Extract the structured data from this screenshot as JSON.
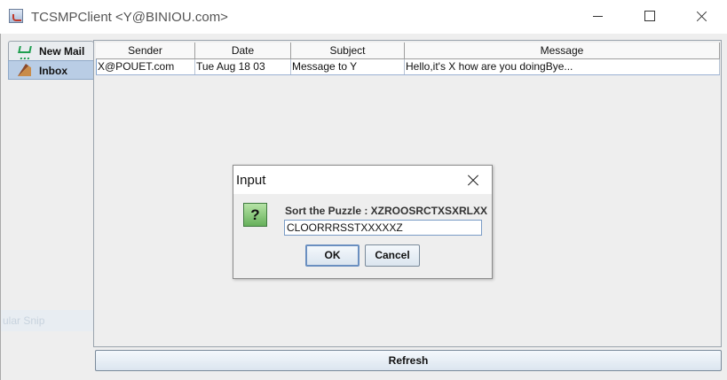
{
  "window": {
    "title": "TCSMPClient <Y@BINIOU.com>",
    "icon": "java-coffee-icon"
  },
  "tabs": [
    {
      "label": "New Mail",
      "icon": "shopping-cart-icon"
    },
    {
      "label": "Inbox",
      "icon": "inbox-icon",
      "selected": true
    }
  ],
  "table": {
    "columns": [
      "Sender",
      "Date",
      "Subject",
      "Message"
    ],
    "rows": [
      {
        "sender": "X@POUET.com",
        "date": "Tue Aug 18 03",
        "subject": "Message to Y",
        "message": "Hello,it's X how are you doingBye..."
      }
    ]
  },
  "refresh_label": "Refresh",
  "background_ghost_text": "ular Snip",
  "dialog": {
    "title": "Input",
    "prompt": "Sort the Puzzle : XZROOSRCTXSXRLXX",
    "input_value": "CLOORRRSSTXXXXXZ",
    "ok_label": "OK",
    "cancel_label": "Cancel",
    "icon": "question-icon"
  },
  "colors": {
    "selected_tab": "#b9cde5",
    "question_icon": "#66b05a",
    "accent_border": "#7a9cc6"
  }
}
